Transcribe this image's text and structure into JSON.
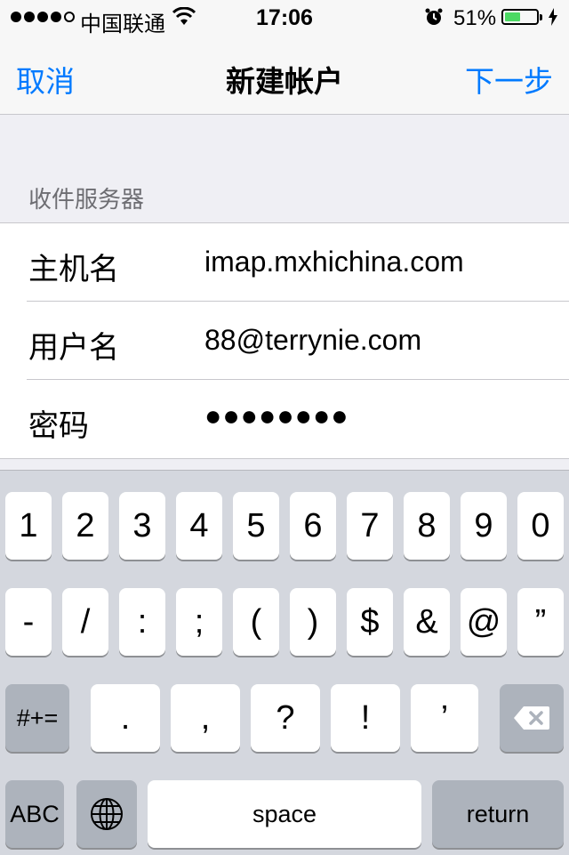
{
  "status_bar": {
    "carrier": "中国联通",
    "time": "17:06",
    "battery_percent": "51%",
    "battery_level": 0.51,
    "signal_bars_filled": 4,
    "signal_bars_total": 5
  },
  "nav": {
    "cancel_label": "取消",
    "title": "新建帐户",
    "next_label": "下一步"
  },
  "section": {
    "header": "收件服务器",
    "rows": [
      {
        "label": "主机名",
        "value": "imap.mxhichina.com"
      },
      {
        "label": "用户名",
        "value": "88@terrynie.com"
      },
      {
        "label": "密码",
        "value": "●●●●●●●●"
      }
    ]
  },
  "keyboard": {
    "row1": [
      "1",
      "2",
      "3",
      "4",
      "5",
      "6",
      "7",
      "8",
      "9",
      "0"
    ],
    "row2": [
      "-",
      "/",
      ":",
      ";",
      "(",
      ")",
      "$",
      "&",
      "@",
      "”"
    ],
    "row3_switch": "#+=",
    "row3": [
      ".",
      ",",
      "?",
      "!",
      "’"
    ],
    "abc_label": "ABC",
    "space_label": "space",
    "return_label": "return"
  },
  "colors": {
    "accent": "#007aff",
    "battery_green": "#4cd964"
  }
}
